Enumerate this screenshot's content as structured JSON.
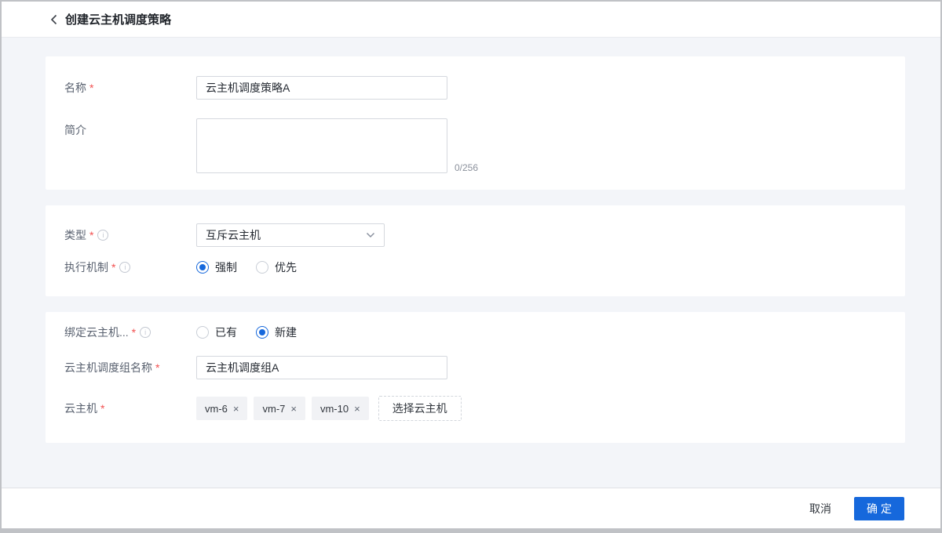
{
  "colors": {
    "primary": "#1668dc",
    "required_red": "#f24f4f",
    "page_bg": "#f3f5f9"
  },
  "icons": {
    "info": "i",
    "remove": "×"
  },
  "required_mark": "*",
  "header": {
    "title": "创建云主机调度策略"
  },
  "form": {
    "name": {
      "label": "名称",
      "required": true,
      "value": "云主机调度策略A"
    },
    "intro": {
      "label": "简介",
      "value": "",
      "counter": "0/256"
    },
    "type": {
      "label": "类型",
      "required": true,
      "value": "互斥云主机"
    },
    "mechanism": {
      "label": "执行机制",
      "required": true,
      "options": [
        {
          "label": "强制",
          "selected": true
        },
        {
          "label": "优先",
          "selected": false
        }
      ]
    },
    "bind_group": {
      "label": "绑定云主机...",
      "required": true,
      "options": [
        {
          "label": "已有",
          "selected": false
        },
        {
          "label": "新建",
          "selected": true
        }
      ]
    },
    "group_name": {
      "label": "云主机调度组名称",
      "required": true,
      "value": "云主机调度组A"
    },
    "vms": {
      "label": "云主机",
      "required": true,
      "tags": [
        "vm-6",
        "vm-7",
        "vm-10"
      ],
      "select_button": "选择云主机"
    }
  },
  "footer": {
    "cancel": "取消",
    "confirm": "确定"
  }
}
